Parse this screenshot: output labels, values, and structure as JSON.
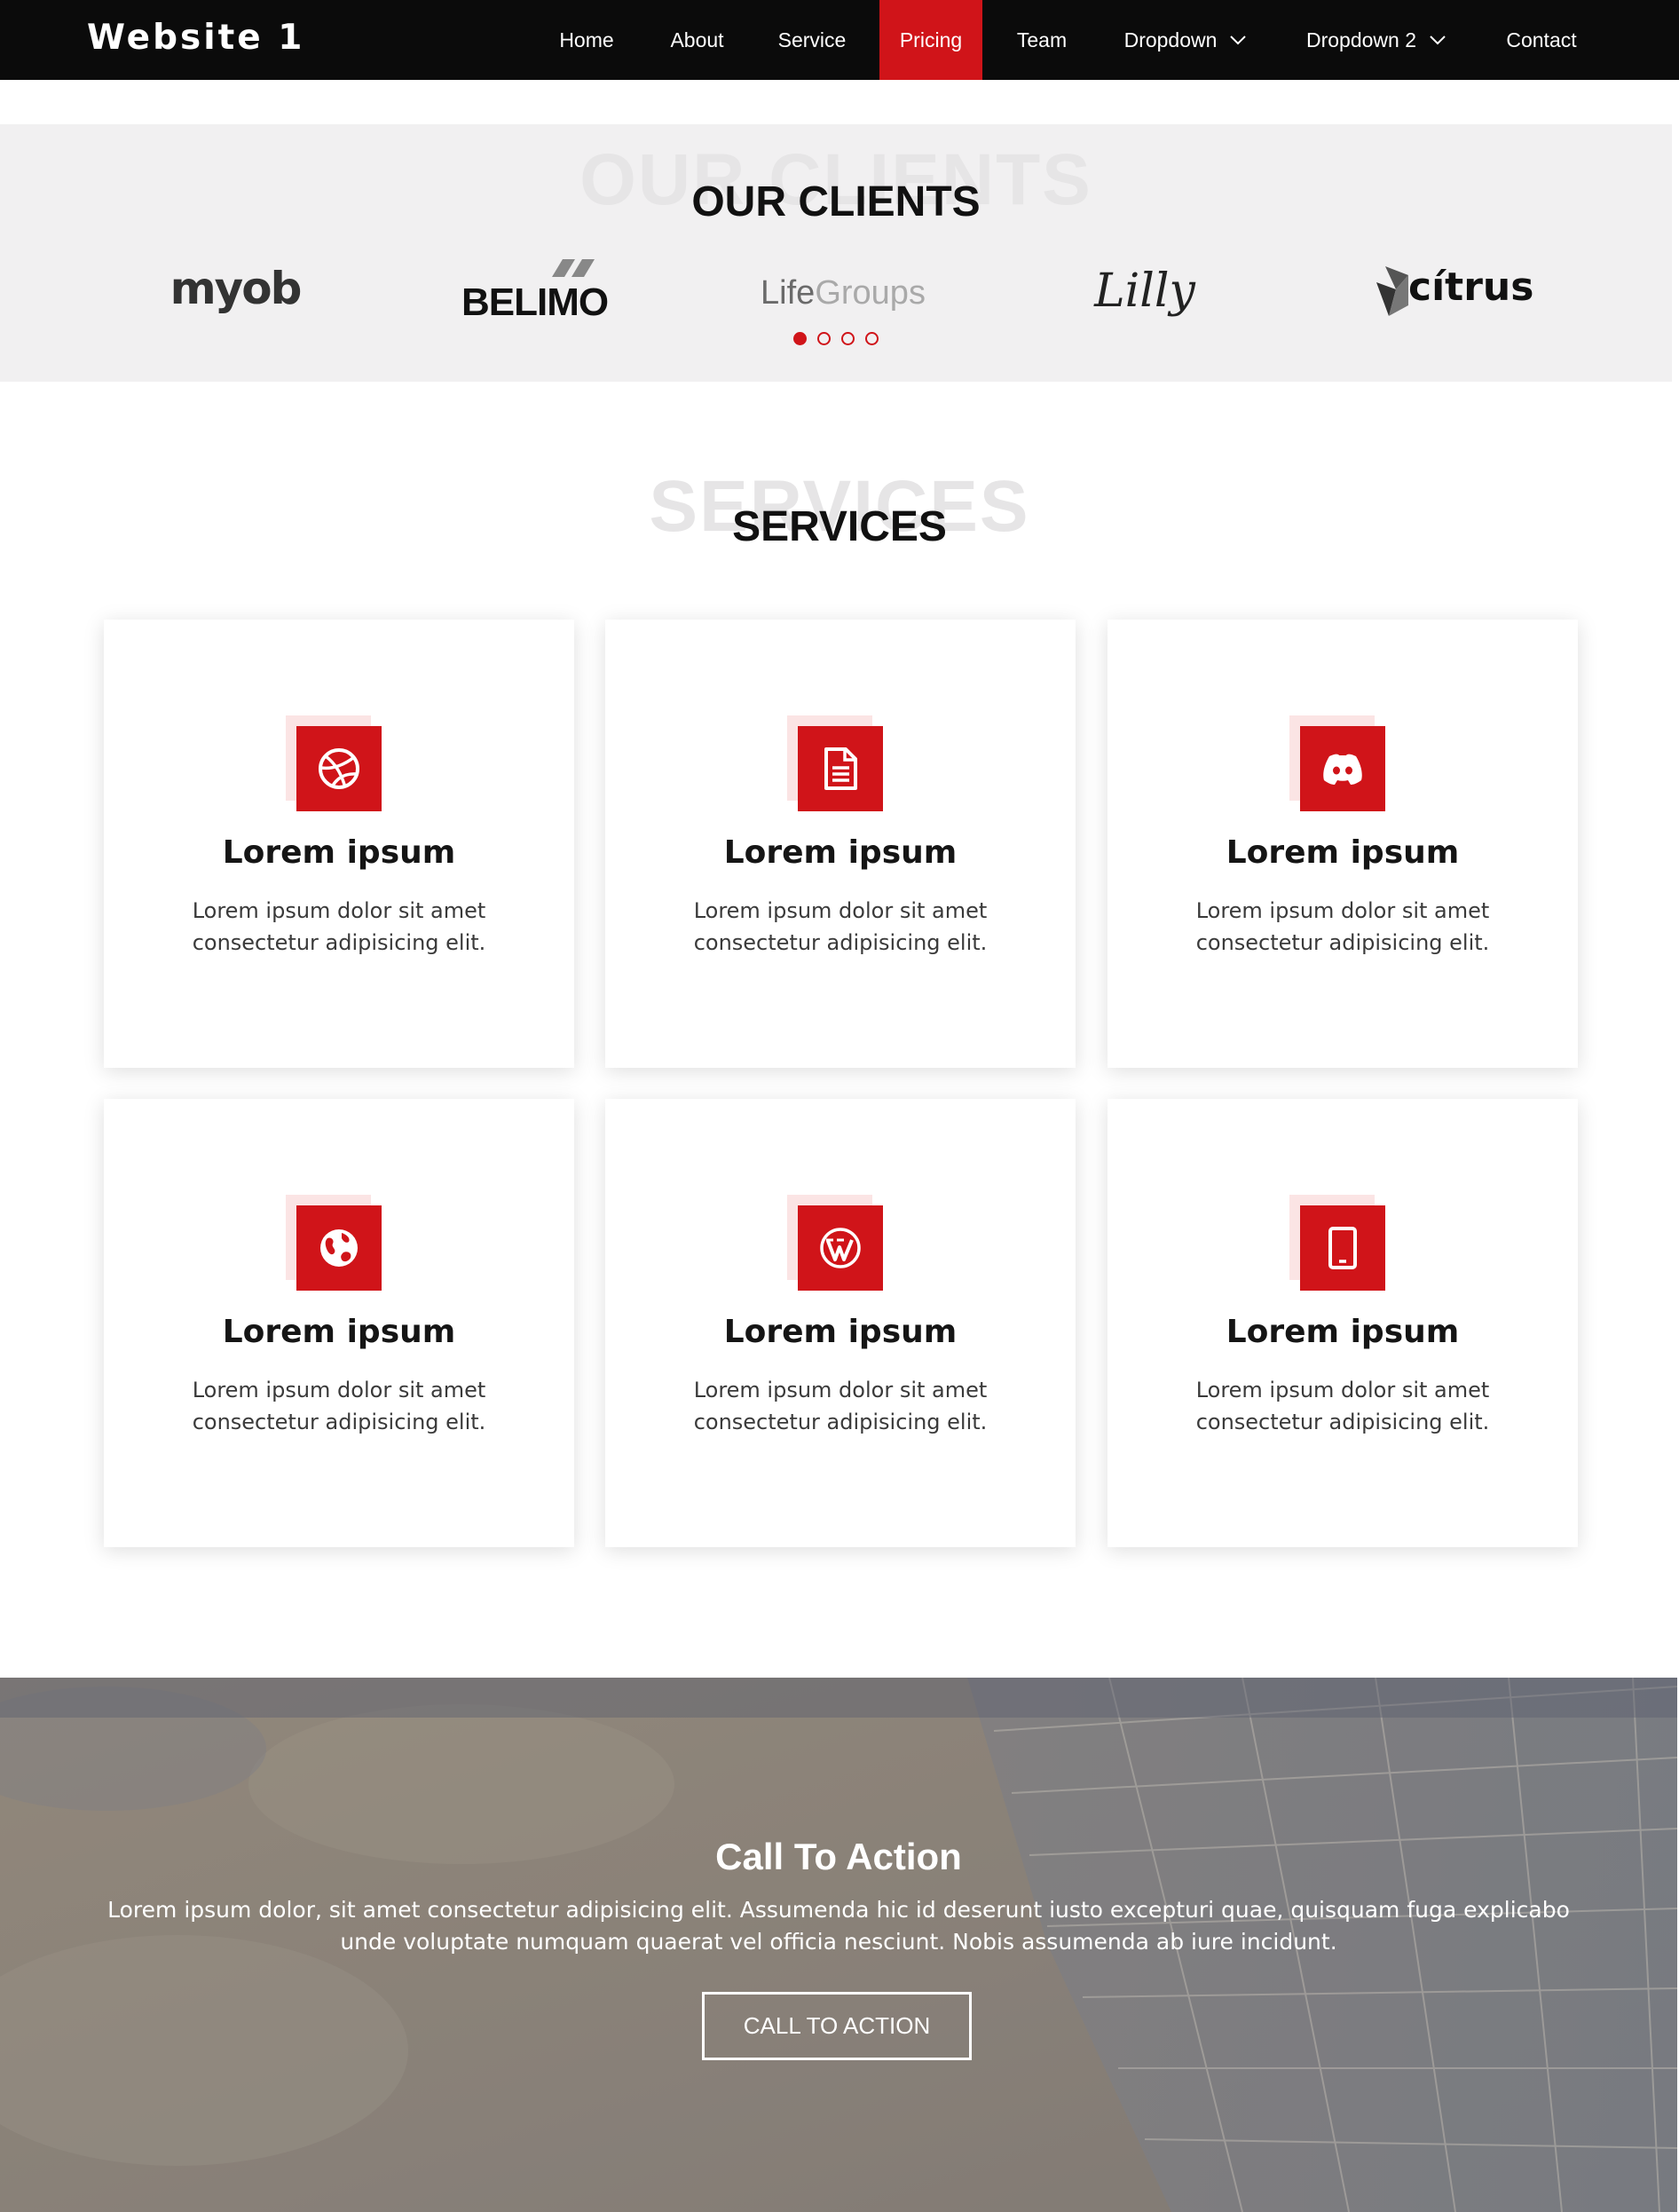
{
  "navbar": {
    "brand": "Website 1",
    "items": [
      {
        "label": "Home"
      },
      {
        "label": "About"
      },
      {
        "label": "Service"
      },
      {
        "label": "Pricing",
        "active": true
      },
      {
        "label": "Team"
      },
      {
        "label": "Dropdown",
        "has_dropdown": true
      },
      {
        "label": "Dropdown 2",
        "has_dropdown": true
      },
      {
        "label": "Contact"
      }
    ]
  },
  "clients": {
    "ghost_title": "OUR CLIENTS",
    "title": "OUR CLIENTS",
    "logos": [
      {
        "name": "myob",
        "text": "myob"
      },
      {
        "name": "belimo",
        "text": "BELIMO"
      },
      {
        "name": "lifegroups",
        "text_life": "Life",
        "text_groups": "Groups"
      },
      {
        "name": "lilly",
        "text": "Lilly"
      },
      {
        "name": "citrus",
        "text": "cítrus"
      }
    ],
    "carousel_pages": 4,
    "carousel_active": 1
  },
  "services": {
    "ghost_title": "SERVICES",
    "title": "SERVICES",
    "cards": [
      {
        "icon": "dribbble-icon",
        "title": "Lorem ipsum",
        "text": "Lorem ipsum dolor sit amet consectetur adipisicing elit."
      },
      {
        "icon": "document-icon",
        "title": "Lorem ipsum",
        "text": "Lorem ipsum dolor sit amet consectetur adipisicing elit."
      },
      {
        "icon": "discord-icon",
        "title": "Lorem ipsum",
        "text": "Lorem ipsum dolor sit amet consectetur adipisicing elit."
      },
      {
        "icon": "globe-icon",
        "title": "Lorem ipsum",
        "text": "Lorem ipsum dolor sit amet consectetur adipisicing elit."
      },
      {
        "icon": "wordpress-icon",
        "title": "Lorem ipsum",
        "text": "Lorem ipsum dolor sit amet consectetur adipisicing elit."
      },
      {
        "icon": "tablet-icon",
        "title": "Lorem ipsum",
        "text": "Lorem ipsum dolor sit amet consectetur adipisicing elit."
      }
    ]
  },
  "cta": {
    "title": "Call To Action",
    "text": "Lorem ipsum dolor, sit amet consectetur adipisicing elit. Assumenda hic id deserunt iusto excepturi quae, quisquam fuga explicabo unde voluptate numquam quaerat vel officia nesciunt. Nobis assumenda ab iure incidunt.",
    "button_label": "CALL TO ACTION"
  },
  "colors": {
    "accent": "#d01419",
    "navbar_bg": "#0b0b0b",
    "clients_bg": "#f1f0f1",
    "icon_shadow": "#fbe4e4"
  }
}
